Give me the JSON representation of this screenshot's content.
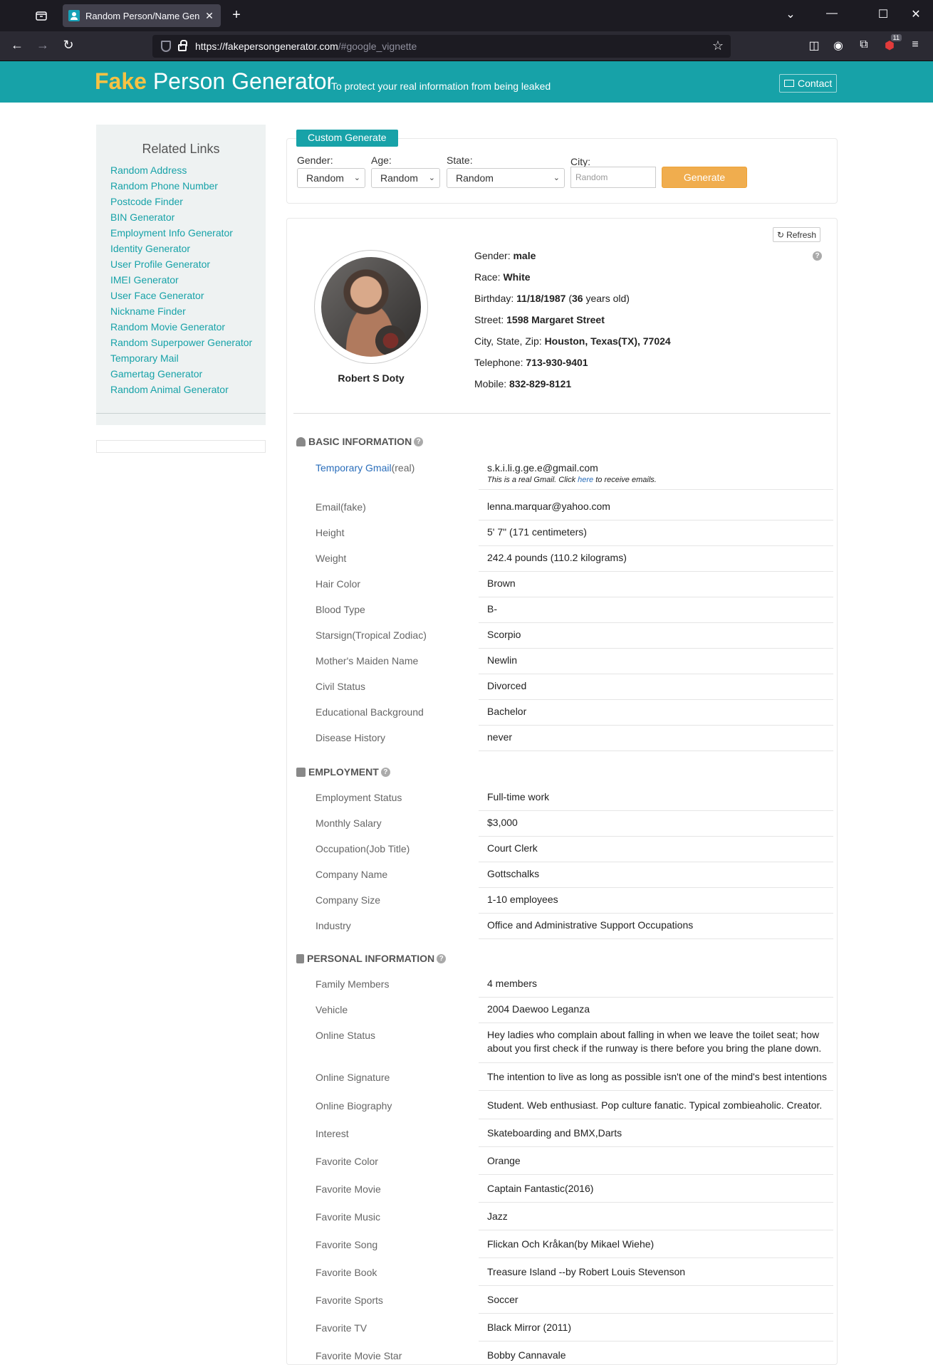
{
  "browser": {
    "tab_title": "Random Person/Name Generat",
    "url_host": "https://fakepersongenerator.com",
    "url_path": "/#google_vignette",
    "badge_count": "11"
  },
  "header": {
    "logo_fake": "Fake",
    "logo_rest": "Person Generator",
    "tagline": "To protect your real information from being leaked",
    "contact_label": "Contact"
  },
  "sidebar": {
    "title": "Related Links",
    "links": [
      "Random Address",
      "Random Phone Number",
      "Postcode Finder",
      "BIN Generator",
      "Employment Info Generator",
      "Identity Generator",
      "User Profile Generator",
      "IMEI Generator",
      "User Face Generator",
      "Nickname Finder",
      "Random Movie Generator",
      "Random Superpower Generator",
      "Temporary Mail",
      "Gamertag Generator",
      "Random Animal Generator"
    ]
  },
  "custom_generate": {
    "tab_label": "Custom Generate",
    "gender_label": "Gender:",
    "gender_value": "Random",
    "age_label": "Age:",
    "age_value": "Random",
    "state_label": "State:",
    "state_value": "Random",
    "city_label": "City:",
    "city_placeholder": "Random",
    "generate_label": "Generate"
  },
  "profile": {
    "refresh_label": "Refresh",
    "name": "Robert S Doty",
    "summary": {
      "gender_label": "Gender:",
      "gender": "male",
      "race_label": "Race:",
      "race": "White",
      "birthday_label": "Birthday:",
      "birthday": "11/18/1987",
      "age": "36",
      "age_suffix": "years old)",
      "street_label": "Street:",
      "street": "1598 Margaret Street",
      "csz_label": "City, State, Zip:",
      "csz": "Houston, Texas(TX), 77024",
      "telephone_label": "Telephone:",
      "telephone": "713-930-9401",
      "mobile_label": "Mobile:",
      "mobile": "832-829-8121"
    }
  },
  "basic": {
    "title": "BASIC INFORMATION",
    "gmail_link": "Temporary Gmail",
    "gmail_suffix": "(real)",
    "gmail_value": "s.k.i.li.g.ge.e@gmail.com",
    "gmail_note_pre": "This is a real Gmail. Click",
    "gmail_note_link": "here",
    "gmail_note_post": "to receive emails.",
    "rows": [
      {
        "k": "Email(fake)",
        "v": "lenna.marquar@yahoo.com"
      },
      {
        "k": "Height",
        "v": "5' 7\" (171 centimeters)"
      },
      {
        "k": "Weight",
        "v": "242.4 pounds (110.2 kilograms)"
      },
      {
        "k": "Hair Color",
        "v": "Brown"
      },
      {
        "k": "Blood Type",
        "v": "B-"
      },
      {
        "k": "Starsign(Tropical Zodiac)",
        "v": "Scorpio"
      },
      {
        "k": "Mother's Maiden Name",
        "v": "Newlin"
      },
      {
        "k": "Civil Status",
        "v": "Divorced"
      },
      {
        "k": "Educational Background",
        "v": "Bachelor"
      },
      {
        "k": "Disease History",
        "v": "never"
      }
    ]
  },
  "employment": {
    "title": "EMPLOYMENT",
    "rows": [
      {
        "k": "Employment Status",
        "v": "Full-time work"
      },
      {
        "k": "Monthly Salary",
        "v": "$3,000"
      },
      {
        "k": "Occupation(Job Title)",
        "v": "Court Clerk"
      },
      {
        "k": "Company Name",
        "v": "Gottschalks"
      },
      {
        "k": "Company Size",
        "v": "1-10 employees"
      },
      {
        "k": "Industry",
        "v": "Office and Administrative Support Occupations"
      }
    ]
  },
  "personal": {
    "title": "PERSONAL INFORMATION",
    "rows": [
      {
        "k": "Family Members",
        "v": "4 members"
      },
      {
        "k": "Vehicle",
        "v": "2004 Daewoo Leganza"
      },
      {
        "k": "Online Status",
        "v": "Hey ladies who complain about falling in when we leave the toilet seat; how about you first check if the runway is there before you bring the plane down."
      },
      {
        "k": "Online Signature",
        "v": "The intention to live as long as possible isn't one of the mind's best intentions"
      },
      {
        "k": "Online Biography",
        "v": "Student. Web enthusiast. Pop culture fanatic. Typical zombieaholic. Creator."
      },
      {
        "k": "Interest",
        "v": "Skateboarding and BMX,Darts"
      },
      {
        "k": "Favorite Color",
        "v": "Orange"
      },
      {
        "k": "Favorite Movie",
        "v": "Captain Fantastic(2016)"
      },
      {
        "k": "Favorite Music",
        "v": "Jazz"
      },
      {
        "k": "Favorite Song",
        "v": "Flickan Och Kråkan(by Mikael Wiehe)"
      },
      {
        "k": "Favorite Book",
        "v": "Treasure Island --by Robert Louis Stevenson"
      },
      {
        "k": "Favorite Sports",
        "v": "Soccer"
      },
      {
        "k": "Favorite TV",
        "v": "Black Mirror (2011)"
      },
      {
        "k": "Favorite Movie Star",
        "v": "Bobby Cannavale"
      }
    ]
  }
}
